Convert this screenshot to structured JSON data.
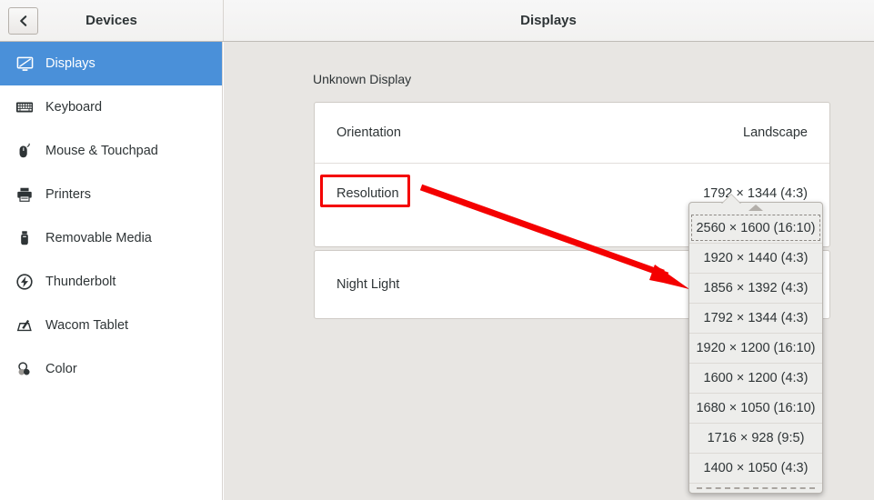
{
  "window": {
    "header": {
      "left_title": "Devices",
      "right_title": "Displays",
      "back_icon": "chevron-left-icon"
    }
  },
  "sidebar": {
    "items": [
      {
        "label": "Displays",
        "icon": "display-icon",
        "selected": true
      },
      {
        "label": "Keyboard",
        "icon": "keyboard-icon",
        "selected": false
      },
      {
        "label": "Mouse & Touchpad",
        "icon": "mouse-icon",
        "selected": false
      },
      {
        "label": "Printers",
        "icon": "printer-icon",
        "selected": false
      },
      {
        "label": "Removable Media",
        "icon": "usb-drive-icon",
        "selected": false
      },
      {
        "label": "Thunderbolt",
        "icon": "thunderbolt-icon",
        "selected": false
      },
      {
        "label": "Wacom Tablet",
        "icon": "wacom-tablet-icon",
        "selected": false
      },
      {
        "label": "Color",
        "icon": "color-profile-icon",
        "selected": false
      }
    ]
  },
  "main": {
    "section_title": "Unknown Display",
    "display_card": {
      "orientation": {
        "label": "Orientation",
        "value": "Landscape"
      },
      "resolution": {
        "label": "Resolution",
        "value": "1792 × 1344 (4:3)"
      }
    },
    "night_light_card": {
      "label": "Night Light"
    }
  },
  "resolution_dropdown": {
    "scroll_up_icon": "scroll-up-arrow-icon",
    "scroll_down_icon": "scroll-down-arrow-icon",
    "options": [
      {
        "label": "2560 × 1600 (16:10)",
        "focused": true
      },
      {
        "label": "1920 × 1440 (4:3)",
        "focused": false
      },
      {
        "label": "1856 × 1392 (4:3)",
        "focused": false
      },
      {
        "label": "1792 × 1344 (4:3)",
        "focused": false
      },
      {
        "label": "1920 × 1200 (16:10)",
        "focused": false
      },
      {
        "label": "1600 × 1200 (4:3)",
        "focused": false
      },
      {
        "label": "1680 × 1050 (16:10)",
        "focused": false
      },
      {
        "label": "1716 × 928 (9:5)",
        "focused": false
      },
      {
        "label": "1400 × 1050 (4:3)",
        "focused": false
      }
    ]
  },
  "annotation": {
    "color": "#f40000",
    "highlight_target": "Resolution",
    "arrow_from": "Resolution",
    "arrow_to": "resolution-dropdown"
  },
  "colors": {
    "selection_blue": "#4a90d9",
    "content_bg": "#e8e6e3",
    "header_bg": "#f2f1f0",
    "annotation_red": "#f40000"
  }
}
